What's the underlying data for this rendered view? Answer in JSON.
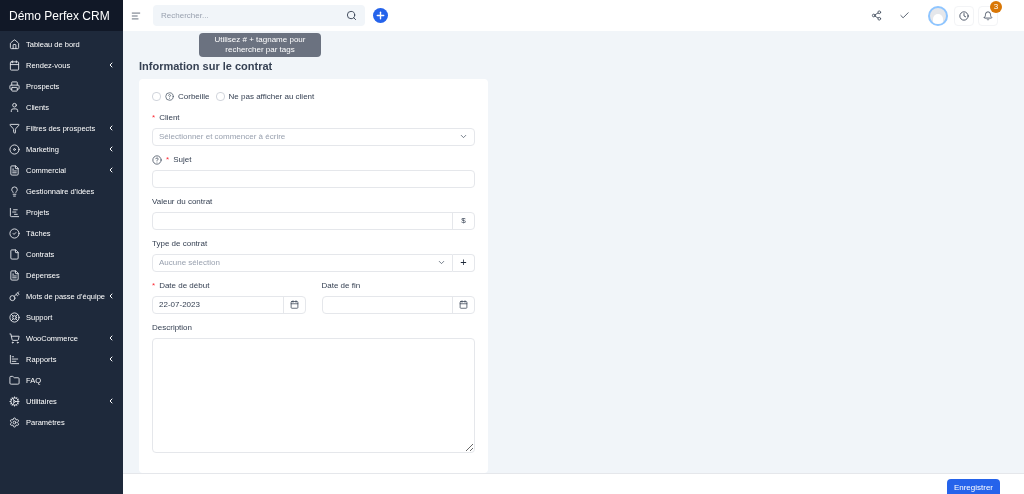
{
  "sidebar": {
    "brand": "Démo Perfex CRM",
    "items": [
      {
        "label": "Tableau de bord",
        "has_submenu": false
      },
      {
        "label": "Rendez-vous",
        "has_submenu": true
      },
      {
        "label": "Prospects",
        "has_submenu": false
      },
      {
        "label": "Clients",
        "has_submenu": false
      },
      {
        "label": "Filtres des prospects",
        "has_submenu": true
      },
      {
        "label": "Marketing",
        "has_submenu": true
      },
      {
        "label": "Commercial",
        "has_submenu": true
      },
      {
        "label": "Gestionnaire d'idées",
        "has_submenu": false
      },
      {
        "label": "Projets",
        "has_submenu": false
      },
      {
        "label": "Tâches",
        "has_submenu": false
      },
      {
        "label": "Contrats",
        "has_submenu": false
      },
      {
        "label": "Dépenses",
        "has_submenu": false
      },
      {
        "label": "Mots de passe d'équipe",
        "has_submenu": true
      },
      {
        "label": "Support",
        "has_submenu": false
      },
      {
        "label": "WooCommerce",
        "has_submenu": true
      },
      {
        "label": "Rapports",
        "has_submenu": true
      },
      {
        "label": "FAQ",
        "has_submenu": false
      },
      {
        "label": "Utilitaires",
        "has_submenu": true
      },
      {
        "label": "Paramètres",
        "has_submenu": false
      }
    ]
  },
  "header": {
    "search": {
      "placeholder": "Rechercher..."
    },
    "tooltip": "Utilisez # + tagname pour rechercher par tags",
    "notifications": "3"
  },
  "form": {
    "title": "Information sur le contrat",
    "checkboxes": [
      {
        "label": "Corbeille",
        "checked": false,
        "help": true
      },
      {
        "label": "Ne pas afficher au client",
        "checked": false,
        "help": false
      }
    ],
    "client": {
      "label": "Client",
      "required_mark": "*",
      "placeholder": "Sélectionner et commencer à écrire"
    },
    "subject": {
      "label": "Sujet",
      "required_mark": "*"
    },
    "value": {
      "label": "Valeur du contrat",
      "addon": "$"
    },
    "type": {
      "label": "Type de contrat",
      "placeholder": "Aucune sélection",
      "addon": "+"
    },
    "start": {
      "label": "Date de début",
      "required_mark": "*",
      "value": "22-07-2023"
    },
    "end": {
      "label": "Date de fin"
    },
    "description": {
      "label": "Description"
    }
  },
  "footer": {
    "save": "Enregistrer"
  }
}
